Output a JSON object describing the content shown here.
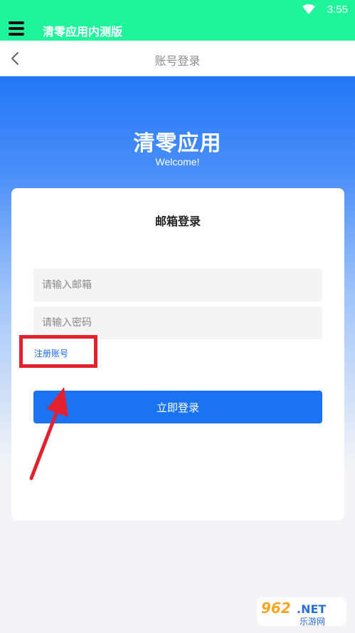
{
  "status_bar": {
    "time": "3:55"
  },
  "app_bar": {
    "title": "清零应用内测版"
  },
  "nav": {
    "title": "账号登录"
  },
  "hero": {
    "title": "清零应用",
    "subtitle": "Welcome!"
  },
  "login_card": {
    "title": "邮箱登录",
    "email_placeholder": "请输入邮箱",
    "email_value": "",
    "password_placeholder": "请输入密码",
    "password_value": "",
    "register_label": "注册账号",
    "submit_label": "立即登录"
  },
  "colors": {
    "app_bar": "#1ff39b",
    "primary": "#1a73f2",
    "link": "#1a66e6",
    "annotation": "#e3202e"
  },
  "icons": [
    "wifi-icon",
    "menu-icon",
    "back-icon"
  ],
  "watermark": {
    "brand": "962.NET",
    "name": "乐游网"
  }
}
